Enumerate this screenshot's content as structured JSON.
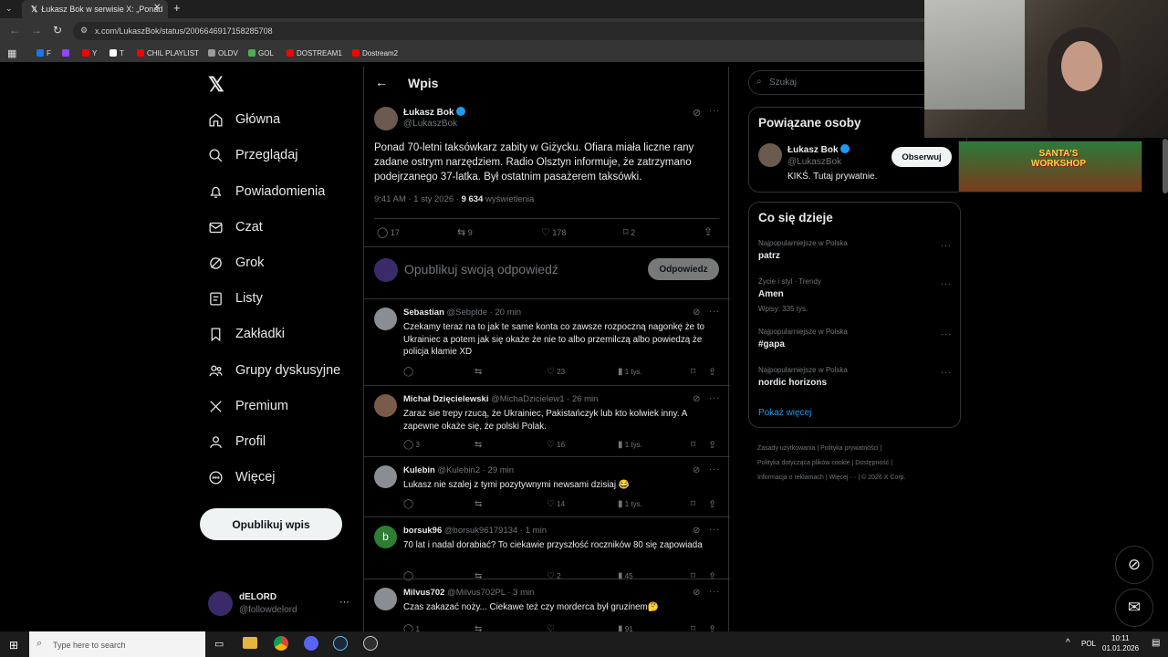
{
  "browser": {
    "tab_title": "Łukasz Bok w serwisie X: „Ponad",
    "url": "x.com/LukaszBok/status/2006646917158285708",
    "bookmarks": [
      {
        "label": "F",
        "color": "#1877f2"
      },
      {
        "label": "",
        "color": "#9146ff"
      },
      {
        "label": "Y",
        "color": "#ff0000"
      },
      {
        "label": "T",
        "color": "#ffffff"
      },
      {
        "label": "CHIL PLAYLIST",
        "color": "#ff0000"
      },
      {
        "label": "OLDV",
        "color": "#9a9a9a"
      },
      {
        "label": "GOL",
        "color": "#4caf50"
      },
      {
        "label": "DOSTREAM1",
        "color": "#ff0000"
      },
      {
        "label": "Dostream2",
        "color": "#ff0000"
      }
    ]
  },
  "nav": {
    "items": [
      {
        "label": "Główna",
        "icon": "home-icon"
      },
      {
        "label": "Przeglądaj",
        "icon": "search-icon"
      },
      {
        "label": "Powiadomienia",
        "icon": "bell-icon"
      },
      {
        "label": "Czat",
        "icon": "mail-icon"
      },
      {
        "label": "Grok",
        "icon": "grok-icon"
      },
      {
        "label": "Listy",
        "icon": "list-icon"
      },
      {
        "label": "Zakładki",
        "icon": "bookmark-icon"
      },
      {
        "label": "Grupy dyskusyjne",
        "icon": "people-icon"
      },
      {
        "label": "Premium",
        "icon": "x-logo-icon"
      },
      {
        "label": "Profil",
        "icon": "person-icon"
      },
      {
        "label": "Więcej",
        "icon": "more-circle-icon"
      }
    ],
    "post_button": "Opublikuj wpis",
    "account_name": "dELORD",
    "account_handle": "@followdelord"
  },
  "post": {
    "header_title": "Wpis",
    "author_name": "Łukasz Bok",
    "author_handle": "@LukaszBok",
    "text": "Ponad 70-letni taksówkarz zabity w Giżycku. Ofiara miała liczne rany zadane ostrym narzędziem. Radio Olsztyn informuje, że zatrzymano podejrzanego 37-latka. Był ostatnim pasażerem taksówki.",
    "time": "9:41 AM · 1 sty 2026 · ",
    "views": "9 634",
    "views_label": " wyświetlenia",
    "replies": "17",
    "reposts": "9",
    "likes": "178",
    "bookmarks": "2",
    "reply_placeholder": "Opublikuj swoją odpowiedź",
    "reply_button": "Odpowiedz"
  },
  "replies": [
    {
      "name": "Sebastian",
      "handle": "@Sebplde · 20 min",
      "text": "Czekamy teraz na to jak te same konta co zawsze rozpoczną nagonkę że to Ukrainiec a potem jak się okaże że nie to albo przemilczą albo powiedzą że policja kłamie XD",
      "replies": "",
      "reposts": "",
      "likes": "23",
      "views": "1 tys.",
      "avatar": "#8a8d91"
    },
    {
      "name": "Michał Dzięcielewski",
      "handle": "@MichaDzicielew1 · 26 min",
      "text": "Zaraz sie trepy rzucą, że Ukrainiec, Pakistańczyk lub kto kolwiek inny. A zapewne okaże się, że polski Polak.",
      "replies": "3",
      "reposts": "",
      "likes": "16",
      "views": "1 tys.",
      "avatar": "#7a5a48"
    },
    {
      "name": "Kulebin",
      "handle": "@Kulebin2 · 29 min",
      "text": "Lukasz nie szalej z tymi pozytywnymi newsami dzisiaj 😂",
      "replies": "",
      "reposts": "",
      "likes": "14",
      "views": "1 tys.",
      "avatar": "#8a8d91"
    },
    {
      "name": "borsuk96",
      "handle": "@borsuk96179134 · 1 min",
      "text": "70 lat i nadal dorabiać? To ciekawie przyszłość roczników 80 się zapowiada",
      "replies": "",
      "reposts": "",
      "likes": "2",
      "views": "45",
      "avatar": "#2e7d32",
      "initial": "b"
    },
    {
      "name": "Milvus702",
      "handle": "@Milvus702PL · 3 min",
      "text": "Czas zakazać noży... Ciekawe też czy morderca był gruzinem🤔",
      "replies": "1",
      "reposts": "",
      "likes": "",
      "views": "91",
      "avatar": "#8a8d91"
    }
  ],
  "right": {
    "search_placeholder": "Szukaj",
    "related_title": "Powiązane osoby",
    "related_name": "Łukasz Bok",
    "related_handle": "@LukaszBok",
    "related_bio": "KIKŚ. Tutaj prywatnie.",
    "follow_button": "Obserwuj",
    "trends_title": "Co się dzieje",
    "trends": [
      {
        "context": "Najpopularniejsze w Polska",
        "name": "patrz",
        "count": ""
      },
      {
        "context": "Życie i styl · Trendy",
        "name": "Amen",
        "count": "Wpisy: 335 tys."
      },
      {
        "context": "Najpopularniejsze w Polska",
        "name": "#gapa",
        "count": ""
      },
      {
        "context": "Najpopularniejsze w Polska",
        "name": "nordic horizons",
        "count": ""
      }
    ],
    "show_more": "Pokaż więcej",
    "footer": [
      "Zasady użytkowania",
      "Polityka prywatności",
      "Polityka dotycząca plików cookie",
      "Dostępność",
      "Informacja o reklamach",
      "Więcej ···",
      "© 2026 X Corp."
    ]
  },
  "overlay": {
    "game_banner": "SANTA'S WORKSHOP"
  },
  "taskbar": {
    "search_placeholder": "Type here to search",
    "lang": "POL",
    "time": "10:11",
    "date": "01.01.2026"
  }
}
